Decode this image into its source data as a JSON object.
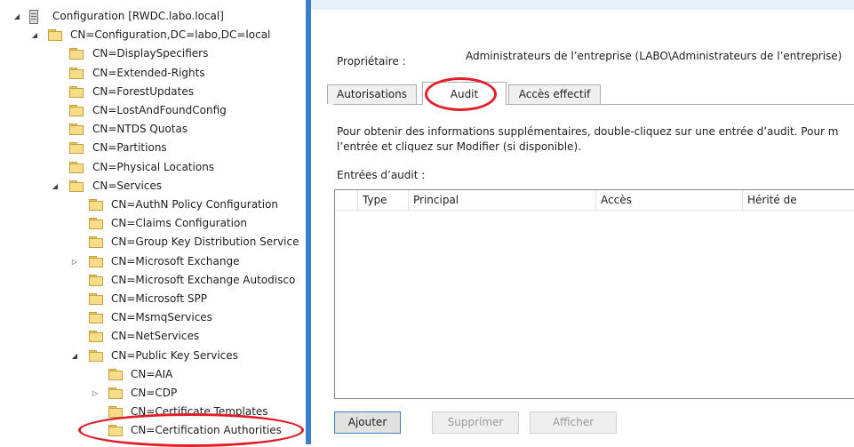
{
  "tree": {
    "items": [
      {
        "label": "Configuration [RWDC.labo.local]",
        "arrow": "◢",
        "icon": "server-icon"
      },
      {
        "label": "CN=Configuration,DC=labo,DC=local",
        "arrow": "◢",
        "icon": "folder-icon"
      },
      {
        "label": "CN=DisplaySpecifiers",
        "arrow": "",
        "icon": "folder-icon"
      },
      {
        "label": "CN=Extended-Rights",
        "arrow": "",
        "icon": "folder-icon"
      },
      {
        "label": "CN=ForestUpdates",
        "arrow": "",
        "icon": "folder-icon"
      },
      {
        "label": "CN=LostAndFoundConfig",
        "arrow": "",
        "icon": "folder-icon"
      },
      {
        "label": "CN=NTDS Quotas",
        "arrow": "",
        "icon": "folder-icon"
      },
      {
        "label": "CN=Partitions",
        "arrow": "",
        "icon": "folder-icon"
      },
      {
        "label": "CN=Physical Locations",
        "arrow": "",
        "icon": "folder-icon"
      },
      {
        "label": "CN=Services",
        "arrow": "◢",
        "icon": "folder-icon"
      },
      {
        "label": "CN=AuthN Policy Configuration",
        "arrow": "",
        "icon": "folder-icon"
      },
      {
        "label": "CN=Claims Configuration",
        "arrow": "",
        "icon": "folder-icon"
      },
      {
        "label": "CN=Group Key Distribution Service",
        "arrow": "",
        "icon": "folder-icon"
      },
      {
        "label": "CN=Microsoft Exchange",
        "arrow": "▷",
        "icon": "folder-icon"
      },
      {
        "label": "CN=Microsoft Exchange Autodisco",
        "arrow": "",
        "icon": "folder-icon"
      },
      {
        "label": "CN=Microsoft SPP",
        "arrow": "",
        "icon": "folder-icon"
      },
      {
        "label": "CN=MsmqServices",
        "arrow": "",
        "icon": "folder-icon"
      },
      {
        "label": "CN=NetServices",
        "arrow": "",
        "icon": "folder-icon"
      },
      {
        "label": "CN=Public Key Services",
        "arrow": "◢",
        "icon": "folder-icon"
      },
      {
        "label": "CN=AIA",
        "arrow": "",
        "icon": "folder-icon"
      },
      {
        "label": "CN=CDP",
        "arrow": "▷",
        "icon": "folder-icon"
      },
      {
        "label": "CN=Certificate Templates",
        "arrow": "",
        "icon": "folder-icon"
      },
      {
        "label": "CN=Certification Authorities",
        "arrow": "",
        "icon": "folder-icon"
      }
    ]
  },
  "panel": {
    "owner_label": "Propriétaire :",
    "owner_value": "Administrateurs de l’entreprise (LABO\\Administrateurs de l’entreprise)",
    "tabs": [
      {
        "label": "Autorisations"
      },
      {
        "label": "Audit"
      },
      {
        "label": "Accès effectif"
      }
    ],
    "info_line1": "Pour obtenir des informations supplémentaires, double-cliquez sur une entrée d’audit. Pour m",
    "info_line2": "l’entrée et cliquez sur Modifier (si disponible).",
    "entries_label": "Entrées d’audit :",
    "columns": [
      "Type",
      "Principal",
      "Accès",
      "Hérité de"
    ],
    "buttons": {
      "add": "Ajouter",
      "remove": "Supprimer",
      "view": "Afficher"
    }
  },
  "colors": {
    "divider": "#3c7fc8",
    "annotation": "#e01e2a",
    "folder": "#f7dc8a"
  }
}
